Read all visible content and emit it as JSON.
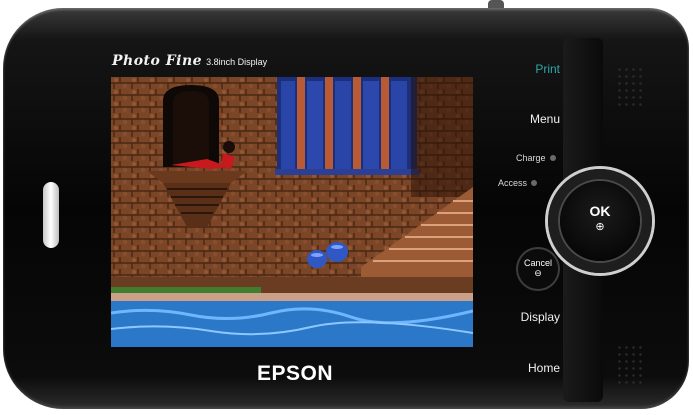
{
  "device": {
    "brand_name": "Photo Fine",
    "brand_sub": "3.8inch Display",
    "vendor": "EPSON"
  },
  "side_buttons": {
    "print": "Print",
    "menu": "Menu",
    "display": "Display",
    "home": "Home"
  },
  "indicators": {
    "charge": "Charge",
    "access": "Access"
  },
  "controls": {
    "ok": "OK",
    "cancel": "Cancel"
  },
  "icons": {
    "ok": "zoom-in-icon",
    "cancel": "zoom-out-icon"
  },
  "colors": {
    "body": "#050505",
    "print_accent": "#2fa6a6",
    "label_text": "#f0f0f0",
    "screen_wall": "#8a4f2e",
    "screen_pool": "#2c78c8"
  }
}
